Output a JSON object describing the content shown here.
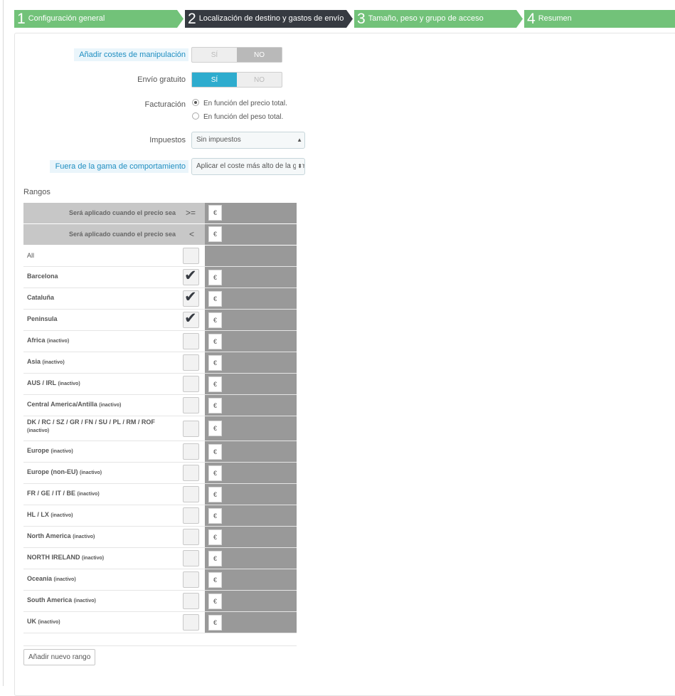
{
  "wizard": {
    "steps": [
      {
        "num": "1",
        "label": "Configuración general"
      },
      {
        "num": "2",
        "label": "Localización de destino y gastos de envío"
      },
      {
        "num": "3",
        "label": "Tamaño, peso y grupo de acceso"
      },
      {
        "num": "4",
        "label": "Resumen"
      }
    ],
    "active_step": 2
  },
  "form": {
    "handling": {
      "label": "Añadir costes de manipulación",
      "yes": "SÍ",
      "no": "NO",
      "value": "NO"
    },
    "free_shipping": {
      "label": "Envío gratuito",
      "yes": "SÍ",
      "no": "NO",
      "value": "SÍ"
    },
    "billing": {
      "label": "Facturación",
      "options": [
        "En función del precio total.",
        "En función del peso total."
      ],
      "selected": 0
    },
    "taxes": {
      "label": "Impuestos",
      "value": "Sin impuestos"
    },
    "out_of_range": {
      "label": "Fuera de la gama de comportamiento",
      "value": "Aplicar el coste más alto de la gama"
    }
  },
  "ranges": {
    "title": "Rangos",
    "header_ge": {
      "label": "Será aplicado cuando el precio sea",
      "op": ">="
    },
    "header_lt": {
      "label": "Será aplicado cuando el precio sea",
      "op": "<"
    },
    "currency": "€",
    "all_label": "All",
    "inactive_tag": "(inactivo)",
    "zones": [
      {
        "name": "Barcelona",
        "checked": true,
        "inactive": false
      },
      {
        "name": "Cataluña",
        "checked": true,
        "inactive": false
      },
      {
        "name": "Peninsula",
        "checked": true,
        "inactive": false
      },
      {
        "name": "Africa",
        "checked": false,
        "inactive": true
      },
      {
        "name": "Asia",
        "checked": false,
        "inactive": true
      },
      {
        "name": "AUS / IRL",
        "checked": false,
        "inactive": true
      },
      {
        "name": "Central America/Antilla",
        "checked": false,
        "inactive": true
      },
      {
        "name": "DK / RC / SZ / GR / FN / SU / PL / RM / ROF",
        "checked": false,
        "inactive": true
      },
      {
        "name": "Europe",
        "checked": false,
        "inactive": true
      },
      {
        "name": "Europe (non-EU)",
        "checked": false,
        "inactive": true
      },
      {
        "name": "FR / GE / IT / BE",
        "checked": false,
        "inactive": true
      },
      {
        "name": "HL / LX",
        "checked": false,
        "inactive": true
      },
      {
        "name": "North America",
        "checked": false,
        "inactive": true
      },
      {
        "name": "NORTH IRELAND",
        "checked": false,
        "inactive": true
      },
      {
        "name": "Oceania",
        "checked": false,
        "inactive": true
      },
      {
        "name": "South America",
        "checked": false,
        "inactive": true
      },
      {
        "name": "UK",
        "checked": false,
        "inactive": true
      }
    ],
    "add_button": "Añadir nuevo rango"
  }
}
